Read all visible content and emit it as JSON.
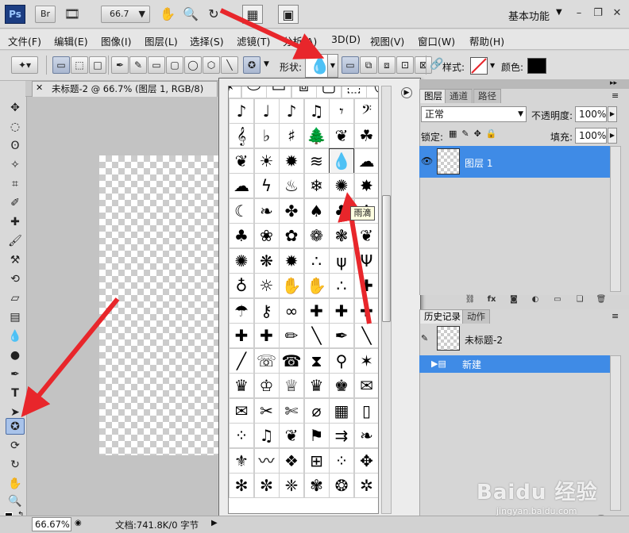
{
  "app": {
    "logo": "Ps",
    "bridge_btn": "Br",
    "zoom_dropdown": "66.7",
    "workspace": "基本功能"
  },
  "menu": [
    "文件(F)",
    "编辑(E)",
    "图像(I)",
    "图层(L)",
    "选择(S)",
    "滤镜(T)",
    "分析(A)",
    "3D(D)",
    "视图(V)",
    "窗口(W)",
    "帮助(H)"
  ],
  "options": {
    "shape_label": "形状:",
    "style_label": "样式:",
    "color_label": "颜色:",
    "color_value": "#000000"
  },
  "document": {
    "tab_title": "未标题-2 @ 66.7% (图层 1, RGB/8)"
  },
  "tooltip": "雨滴",
  "shapes": [
    [
      "sparkle-frame",
      "oval-frame",
      "rect-frame",
      "stamp-frame",
      "scroll-frame",
      "tag-frame",
      "ring-frame"
    ],
    [
      "sixteenth-note",
      "quarter-note",
      "eighth-note",
      "double-eighth-note",
      "eighth-rest",
      "bass-clef"
    ],
    [
      "treble-clef",
      "flat-sign",
      "sharp-sign",
      "tree",
      "fern",
      "shamrock"
    ],
    [
      "butterfly",
      "sun",
      "starburst",
      "waves",
      "raindrop",
      "cloud"
    ],
    [
      "puffy-cloud",
      "lightning",
      "fire",
      "snowflake",
      "splat",
      "speech-burst"
    ],
    [
      "moon",
      "leaf",
      "maple-leaf",
      "leaf-2",
      "bird-leaf",
      "maple-leaf-2"
    ],
    [
      "tree-2",
      "fleur-leaf",
      "flower",
      "floral-ornament",
      "floral-ornament-2",
      "ivy-leaf"
    ],
    [
      "flower-6",
      "daisy",
      "sunflower",
      "speckle",
      "grass",
      "grass-2"
    ],
    [
      "lightbulb",
      "lightbulb-2",
      "hand",
      "hand-2",
      "footprint",
      "puzzle-piece"
    ],
    [
      "umbrella",
      "key",
      "bow",
      "puzzle-2",
      "puzzle-3",
      "puzzle-4"
    ],
    [
      "puzzle-5",
      "puzzle-6",
      "pencil",
      "brush",
      "pen",
      "marker"
    ],
    [
      "knife",
      "telephone",
      "telephone-2",
      "hourglass",
      "thumbtack",
      "sheriff-star"
    ],
    [
      "crown",
      "crown-2",
      "crown-3",
      "crown-4",
      "crown-5",
      "envelope"
    ],
    [
      "envelope-2",
      "scissors",
      "scissors-2",
      "paperclip",
      "stamp",
      "blank-frame"
    ],
    [
      "dots",
      "music-notes",
      "bird-silhouettes",
      "us-flag",
      "arrows",
      "ornament"
    ],
    [
      "fleur-de-lis",
      "dash-ornament",
      "tile",
      "tile-2",
      "tile-3",
      "tile-4"
    ],
    [
      "tile-5",
      "tile-6",
      "tile-7",
      "tile-8",
      "tile-9",
      "tile-10"
    ]
  ],
  "layers_panel": {
    "tabs": [
      "图层",
      "通道",
      "路径"
    ],
    "blend_mode": "正常",
    "opacity_label": "不透明度:",
    "opacity_value": "100%",
    "lock_label": "锁定:",
    "fill_label": "填充:",
    "fill_value": "100%",
    "layer_name": "图层 1"
  },
  "history_panel": {
    "tabs": [
      "历史记录",
      "动作"
    ],
    "snapshot_name": "未标题-2",
    "step_name": "新建"
  },
  "status": {
    "zoom": "66.67%",
    "doc_info": "文档:741.8K/0 字节"
  },
  "watermark": {
    "main": "Baidu 经验",
    "sub": "jingyan.baidu.com"
  },
  "annotation_color": "#e8262b"
}
